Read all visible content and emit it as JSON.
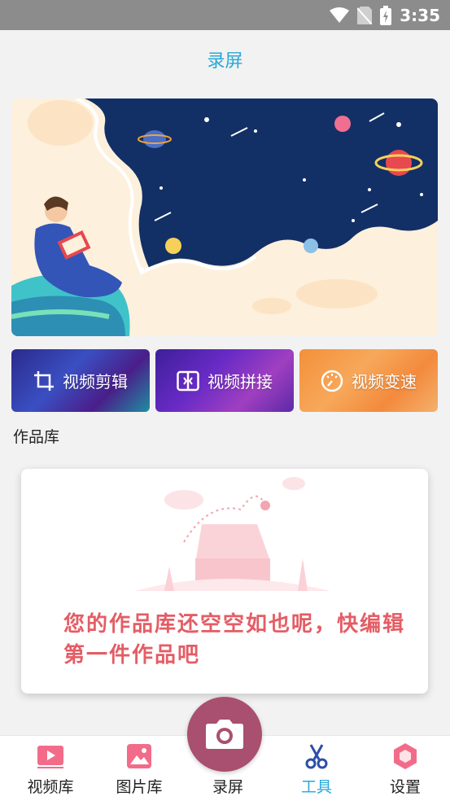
{
  "status_bar": {
    "time": "3:35"
  },
  "header": {
    "title": "录屏"
  },
  "tools": [
    {
      "label": "视频剪辑"
    },
    {
      "label": "视频拼接"
    },
    {
      "label": "视频变速"
    }
  ],
  "library": {
    "section_title": "作品库",
    "empty_message": "您的作品库还空空如也呢，快编辑第一件作品吧"
  },
  "bottom_nav": {
    "items": [
      {
        "label": "视频库"
      },
      {
        "label": "图片库"
      },
      {
        "label": "录屏"
      },
      {
        "label": "工具"
      },
      {
        "label": "设置"
      }
    ],
    "active_color": "#27a8d8"
  },
  "colors": {
    "accent": "#27a8d8",
    "fab": "#a94f6f",
    "empty_text": "#e45d65"
  },
  "icons": [
    "wifi-icon",
    "no-sim-icon",
    "battery-icon",
    "crop-icon",
    "merge-icon",
    "speed-icon",
    "play-video-icon",
    "image-icon",
    "camera-icon",
    "scissors-icon",
    "hexagon-settings-icon"
  ]
}
